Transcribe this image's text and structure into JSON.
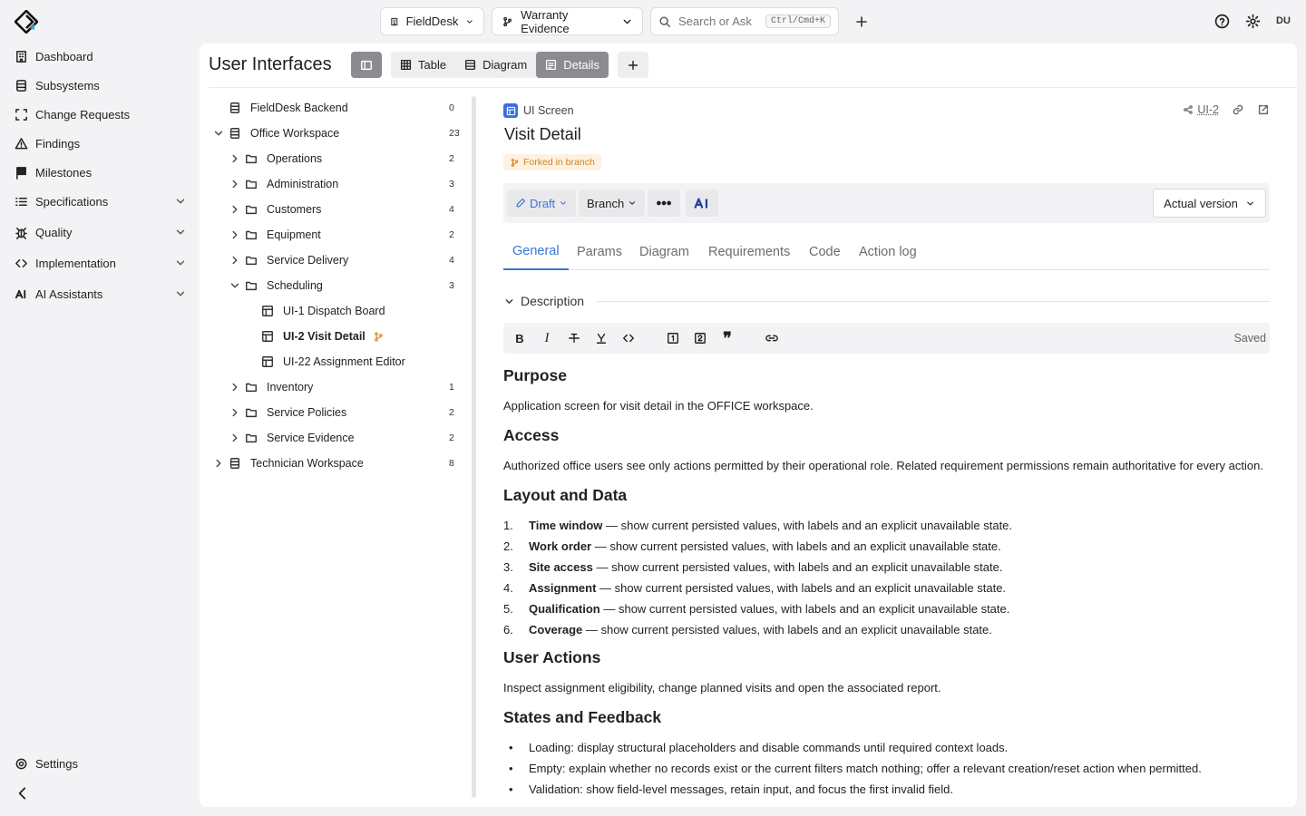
{
  "topbar": {
    "project": "FieldDesk",
    "branch": "Warranty Evidence",
    "search_placeholder": "Search or Ask",
    "search_shortcut": "Ctrl/Cmd+K",
    "user_initials": "DU"
  },
  "sidebar": {
    "items": [
      {
        "label": "Dashboard",
        "icon": "building-icon"
      },
      {
        "label": "Subsystems",
        "icon": "database-icon"
      },
      {
        "label": "Change Requests",
        "icon": "scan-icon"
      },
      {
        "label": "Findings",
        "icon": "warning-icon"
      },
      {
        "label": "Milestones",
        "icon": "flag-icon"
      },
      {
        "label": "Specifications",
        "icon": "list-icon",
        "expandable": true
      },
      {
        "label": "Quality",
        "icon": "bug-icon",
        "expandable": true
      },
      {
        "label": "Implementation",
        "icon": "code-icon",
        "expandable": true
      },
      {
        "label": "AI Assistants",
        "icon": "ai-icon",
        "expandable": true
      }
    ],
    "settings": "Settings"
  },
  "page": {
    "title": "User Interfaces",
    "views": [
      "Table",
      "Diagram",
      "Details"
    ],
    "active_view": "Details"
  },
  "tree": {
    "rows": [
      {
        "label": "FieldDesk Backend",
        "count": "0"
      },
      {
        "label": "Office Workspace",
        "count": "23"
      },
      {
        "label": "Operations",
        "count": "2"
      },
      {
        "label": "Administration",
        "count": "3"
      },
      {
        "label": "Customers",
        "count": "4"
      },
      {
        "label": "Equipment",
        "count": "2"
      },
      {
        "label": "Service Delivery",
        "count": "4"
      },
      {
        "label": "Scheduling",
        "count": "3"
      },
      {
        "label": "UI-1 Dispatch Board",
        "count": ""
      },
      {
        "label": "UI-2 Visit Detail",
        "count": ""
      },
      {
        "label": "UI-22 Assignment Editor",
        "count": ""
      },
      {
        "label": "Inventory",
        "count": "1"
      },
      {
        "label": "Service Policies",
        "count": "2"
      },
      {
        "label": "Service Evidence",
        "count": "2"
      },
      {
        "label": "Technician Workspace",
        "count": "8"
      }
    ]
  },
  "detail": {
    "type": "UI Screen",
    "id": "UI-2",
    "title": "Visit Detail",
    "forked_badge": "Forked in branch",
    "status": "Draft",
    "branch_btn": "Branch",
    "ai_btn": "AI",
    "version": "Actual version",
    "tabs": [
      "General",
      "Params",
      "Diagram",
      "Requirements",
      "Code",
      "Action log"
    ],
    "description_label": "Description",
    "saved": "Saved"
  },
  "content": {
    "purpose_h": "Purpose",
    "purpose_p": "Application screen for visit detail in the OFFICE workspace.",
    "access_h": "Access",
    "access_p": "Authorized office users see only actions permitted by their operational role. Related requirement permissions remain authoritative for every action.",
    "layout_h": "Layout and Data",
    "layout_items": [
      {
        "n": "1.",
        "term": "Time window",
        "text": " — show current persisted values, with labels and an explicit unavailable state."
      },
      {
        "n": "2.",
        "term": "Work order",
        "text": " — show current persisted values, with labels and an explicit unavailable state."
      },
      {
        "n": "3.",
        "term": "Site access",
        "text": " — show current persisted values, with labels and an explicit unavailable state."
      },
      {
        "n": "4.",
        "term": "Assignment",
        "text": " — show current persisted values, with labels and an explicit unavailable state."
      },
      {
        "n": "5.",
        "term": "Qualification",
        "text": " — show current persisted values, with labels and an explicit unavailable state."
      },
      {
        "n": "6.",
        "term": "Coverage",
        "text": " — show current persisted values, with labels and an explicit unavailable state."
      }
    ],
    "actions_h": "User Actions",
    "actions_p": "Inspect assignment eligibility, change planned visits and open the associated report.",
    "states_h": "States and Feedback",
    "states_items": [
      "Loading: display structural placeholders and disable commands until required context loads.",
      "Empty: explain whether no records exist or the current filters match nothing; offer a relevant creation/reset action when permitted.",
      "Validation: show field-level messages, retain input, and focus the first invalid field."
    ]
  },
  "colors": {
    "accent": "#3d74d6",
    "forked": "#d08520",
    "type_badge": "#3b6fe0"
  }
}
